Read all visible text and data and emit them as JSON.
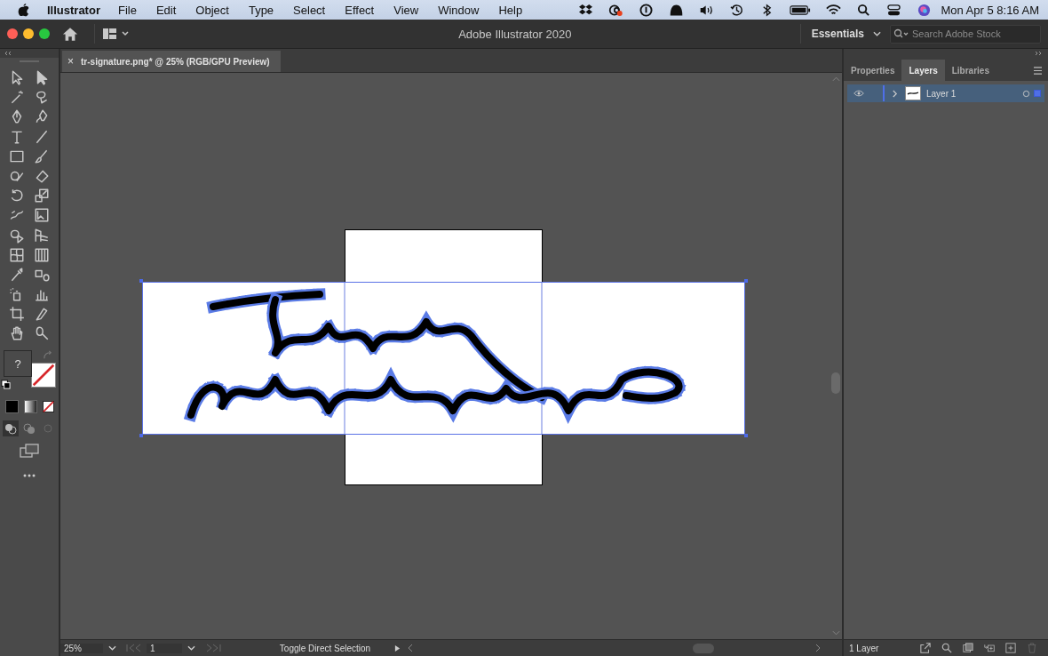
{
  "menu_bar": {
    "app": "Illustrator",
    "items": [
      "File",
      "Edit",
      "Object",
      "Type",
      "Select",
      "Effect",
      "View",
      "Window",
      "Help"
    ],
    "clock": "Mon Apr 5  8:16 AM"
  },
  "window": {
    "title": "Adobe Illustrator 2020",
    "workspace": "Essentials",
    "search": {
      "placeholder": "Search Adobe Stock"
    }
  },
  "document_tab": {
    "close": "×",
    "title": "tr-signature.png* @ 25% (RGB/GPU Preview)"
  },
  "toolbar": {
    "fill_stroke_help": "?"
  },
  "panel": {
    "tabs": [
      {
        "label": "Properties",
        "selected": false
      },
      {
        "label": "Layers",
        "selected": true
      },
      {
        "label": "Libraries",
        "selected": false
      }
    ],
    "layers": [
      {
        "name": "Layer 1",
        "visible": true,
        "expanded": false,
        "selected": true
      }
    ],
    "footer": "1 Layer"
  },
  "status_bar": {
    "zoom": "25%",
    "artboard": "1",
    "status": "Toggle Direct Selection"
  }
}
